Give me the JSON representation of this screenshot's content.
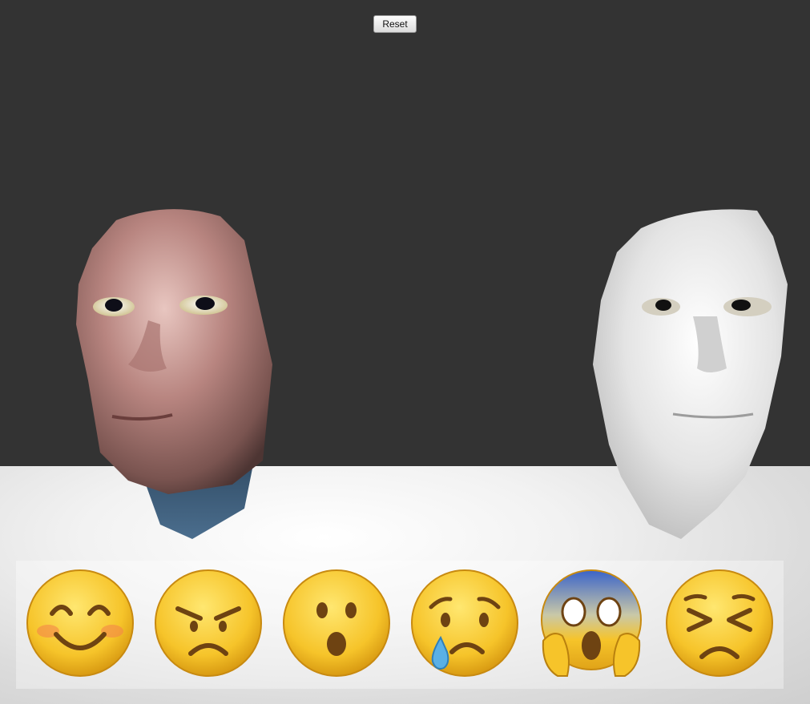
{
  "toolbar": {
    "reset_label": "Reset"
  },
  "emotions": [
    {
      "icon": "smiling-face-icon"
    },
    {
      "icon": "angry-face-icon"
    },
    {
      "icon": "surprised-face-icon"
    },
    {
      "icon": "crying-face-icon"
    },
    {
      "icon": "screaming-in-fear-face-icon"
    },
    {
      "icon": "persevering-face-icon"
    }
  ],
  "colors": {
    "background": "#333333",
    "emoji_yellow": "#f6c42a",
    "emoji_brown": "#6e4312",
    "model_skin": "#e6e6e6"
  }
}
